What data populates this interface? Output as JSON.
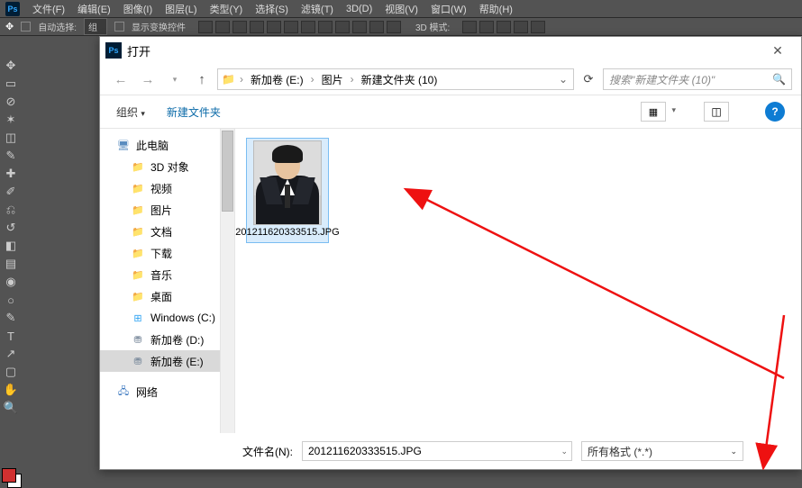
{
  "ps": {
    "menu": [
      "文件(F)",
      "编辑(E)",
      "图像(I)",
      "图层(L)",
      "类型(Y)",
      "选择(S)",
      "滤镜(T)",
      "3D(D)",
      "视图(V)",
      "窗口(W)",
      "帮助(H)"
    ],
    "autoSelect": "自动选择:",
    "selectMode": "组",
    "showTransform": "显示变换控件",
    "mode3d": "3D 模式:"
  },
  "dialog": {
    "title": "打开",
    "breadcrumb": {
      "root": "",
      "items": [
        "新加卷 (E:)",
        "图片",
        "新建文件夹 (10)"
      ]
    },
    "searchPlaceholder": "搜索\"新建文件夹 (10)\"",
    "organize": "组织",
    "newFolder": "新建文件夹",
    "tree": [
      {
        "label": "此电脑",
        "icon": "pc",
        "indent": false
      },
      {
        "label": "3D 对象",
        "icon": "folder",
        "indent": true
      },
      {
        "label": "视频",
        "icon": "folder",
        "indent": true
      },
      {
        "label": "图片",
        "icon": "folder",
        "indent": true
      },
      {
        "label": "文档",
        "icon": "folder",
        "indent": true
      },
      {
        "label": "下载",
        "icon": "folder",
        "indent": true
      },
      {
        "label": "音乐",
        "icon": "folder",
        "indent": true
      },
      {
        "label": "桌面",
        "icon": "folder",
        "indent": true
      },
      {
        "label": "Windows (C:)",
        "icon": "win",
        "indent": true
      },
      {
        "label": "新加卷 (D:)",
        "icon": "drive",
        "indent": true
      },
      {
        "label": "新加卷 (E:)",
        "icon": "drive",
        "indent": true,
        "selected": true
      }
    ],
    "network": "网络",
    "file": {
      "name": "201211620333515.JPG"
    },
    "fnLabel": "文件名(N):",
    "fnValue": "201211620333515.JPG",
    "filter": "所有格式 (*.*)"
  }
}
